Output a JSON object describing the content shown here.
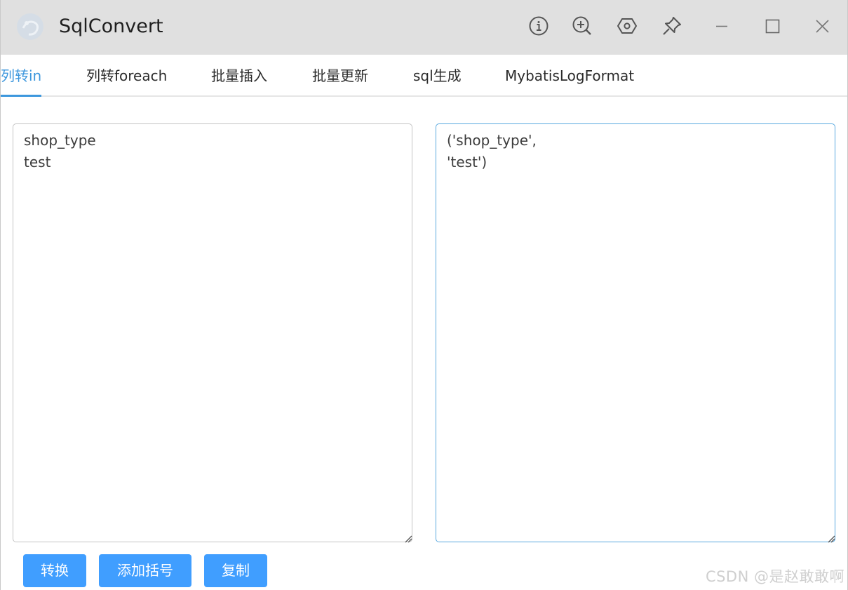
{
  "window": {
    "title": "SqlConvert",
    "toolbar_icons": [
      "info-icon",
      "zoom-in-icon",
      "settings-hexagon-icon",
      "pin-icon",
      "minimize-icon",
      "maximize-icon",
      "close-icon"
    ]
  },
  "tabs": [
    {
      "label": "列转in",
      "active": true
    },
    {
      "label": "列转foreach",
      "active": false
    },
    {
      "label": "批量插入",
      "active": false
    },
    {
      "label": "批量更新",
      "active": false
    },
    {
      "label": "sql生成",
      "active": false
    },
    {
      "label": "MybatisLogFormat",
      "active": false
    }
  ],
  "editor": {
    "input_text": "shop_type\ntest",
    "output_text": "('shop_type',\n'test')"
  },
  "buttons": {
    "convert": "转换",
    "add_brackets": "添加括号",
    "copy": "复制"
  },
  "watermark": "CSDN @是赵敢敢啊",
  "colors": {
    "accent": "#409eff",
    "active_tab": "#3d97dd",
    "titlebar": "#e0e0e0"
  }
}
